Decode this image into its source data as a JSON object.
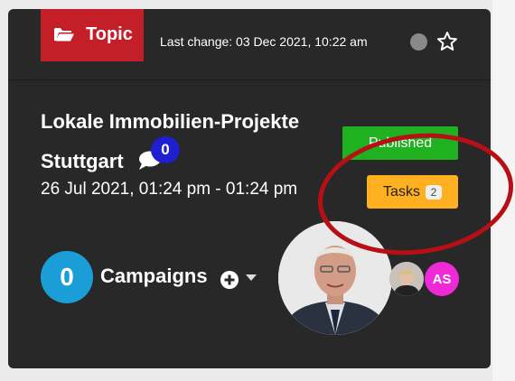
{
  "topic": {
    "tag_label": "Topic",
    "icon": "folder-open-icon",
    "color": "#c41e28"
  },
  "header": {
    "last_change": "Last change: 03 Dec 2021, 10:22 am",
    "favorite_icon": "star-outline-icon"
  },
  "event": {
    "title_line1": "Lokale Immobilien-Projekte",
    "title_line2": "Stuttgart",
    "comment_count": "0",
    "date_range": "26 Jul 2021, 01:24 pm - 01:24 pm"
  },
  "status": {
    "published_label": "Published",
    "published_color": "#1fb11f"
  },
  "tasks": {
    "label": "Tasks",
    "count": "2",
    "color": "#ffb020"
  },
  "campaigns": {
    "count": "0",
    "label": "Campaigns",
    "add_icon": "plus-circle-icon",
    "menu_icon": "caret-down-icon"
  },
  "assignees": {
    "initials": "AS",
    "initials_color": "#ee2ad6"
  },
  "annotation": {
    "color": "#b80f16"
  }
}
